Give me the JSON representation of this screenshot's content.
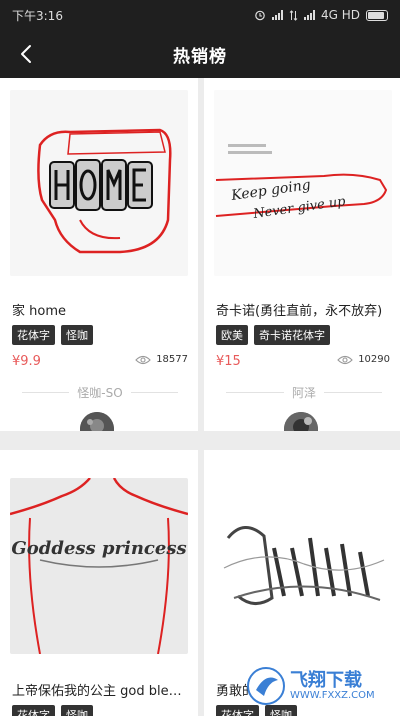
{
  "statusbar": {
    "time": "下午3:16",
    "network": "4G HD"
  },
  "navbar": {
    "title": "热销榜"
  },
  "cards": [
    {
      "title": "家 home",
      "tags": [
        "花体字",
        "怪咖"
      ],
      "price": "¥9.9",
      "views": "18577",
      "author": "怪咖-SO"
    },
    {
      "title": "奇卡诺(勇往直前，永不放弃)",
      "tags": [
        "欧美",
        "奇卡诺花体字"
      ],
      "price": "¥15",
      "views": "10290",
      "author": "阿泽",
      "art_text": [
        "Keep going",
        "Never give up"
      ]
    },
    {
      "title": "上帝保佑我的公主 god bless...",
      "tags": [
        "花体字",
        "怪咖"
      ],
      "art_text": "Goddess princess"
    },
    {
      "title": "勇敢的",
      "tags": [
        "花体字",
        "怪咖"
      ]
    }
  ],
  "watermark": {
    "text": "飞翔下载",
    "url": "WWW.FXXZ.COM"
  },
  "colors": {
    "bar": "#1f1f1f",
    "price": "#e85a5a",
    "tag": "#333333",
    "watermark": "#3a7fd5"
  }
}
